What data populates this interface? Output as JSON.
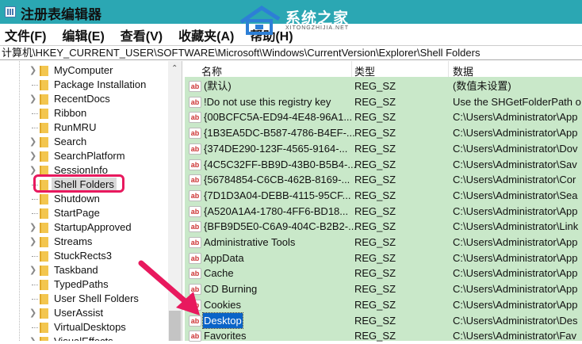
{
  "window": {
    "title": "注册表编辑器"
  },
  "watermark": {
    "name": "系统之家",
    "url": "XITONGZHIJIA.NET"
  },
  "menu": [
    "文件(F)",
    "编辑(E)",
    "查看(V)",
    "收藏夹(A)",
    "帮助(H)"
  ],
  "address": "计算机\\HKEY_CURRENT_USER\\SOFTWARE\\Microsoft\\Windows\\CurrentVersion\\Explorer\\Shell Folders",
  "tree": [
    {
      "label": "MyComputer",
      "expandable": true
    },
    {
      "label": "Package Installation",
      "expandable": false
    },
    {
      "label": "RecentDocs",
      "expandable": true
    },
    {
      "label": "Ribbon",
      "expandable": false
    },
    {
      "label": "RunMRU",
      "expandable": false
    },
    {
      "label": "Search",
      "expandable": true
    },
    {
      "label": "SearchPlatform",
      "expandable": true
    },
    {
      "label": "SessionInfo",
      "expandable": true
    },
    {
      "label": "Shell Folders",
      "expandable": false,
      "selected": true
    },
    {
      "label": "Shutdown",
      "expandable": false
    },
    {
      "label": "StartPage",
      "expandable": false
    },
    {
      "label": "StartupApproved",
      "expandable": true
    },
    {
      "label": "Streams",
      "expandable": true
    },
    {
      "label": "StuckRects3",
      "expandable": false
    },
    {
      "label": "Taskband",
      "expandable": true
    },
    {
      "label": "TypedPaths",
      "expandable": false
    },
    {
      "label": "User Shell Folders",
      "expandable": false
    },
    {
      "label": "UserAssist",
      "expandable": true
    },
    {
      "label": "VirtualDesktops",
      "expandable": false
    },
    {
      "label": "VisualEffects",
      "expandable": true
    }
  ],
  "columns": {
    "name": "名称",
    "type": "类型",
    "data": "数据"
  },
  "rows": [
    {
      "name": "(默认)",
      "type": "REG_SZ",
      "data": "(数值未设置)"
    },
    {
      "name": "!Do not use this registry key",
      "type": "REG_SZ",
      "data": "Use the SHGetFolderPath o"
    },
    {
      "name": "{00BCFC5A-ED94-4E48-96A1...",
      "type": "REG_SZ",
      "data": "C:\\Users\\Administrator\\App"
    },
    {
      "name": "{1B3EA5DC-B587-4786-B4EF-...",
      "type": "REG_SZ",
      "data": "C:\\Users\\Administrator\\App"
    },
    {
      "name": "{374DE290-123F-4565-9164-...",
      "type": "REG_SZ",
      "data": "C:\\Users\\Administrator\\Dov"
    },
    {
      "name": "{4C5C32FF-BB9D-43B0-B5B4-...",
      "type": "REG_SZ",
      "data": "C:\\Users\\Administrator\\Sav"
    },
    {
      "name": "{56784854-C6CB-462B-8169-...",
      "type": "REG_SZ",
      "data": "C:\\Users\\Administrator\\Cor"
    },
    {
      "name": "{7D1D3A04-DEBB-4115-95CF...",
      "type": "REG_SZ",
      "data": "C:\\Users\\Administrator\\Sea"
    },
    {
      "name": "{A520A1A4-1780-4FF6-BD18...",
      "type": "REG_SZ",
      "data": "C:\\Users\\Administrator\\App"
    },
    {
      "name": "{BFB9D5E0-C6A9-404C-B2B2-...",
      "type": "REG_SZ",
      "data": "C:\\Users\\Administrator\\Link"
    },
    {
      "name": "Administrative Tools",
      "type": "REG_SZ",
      "data": "C:\\Users\\Administrator\\App"
    },
    {
      "name": "AppData",
      "type": "REG_SZ",
      "data": "C:\\Users\\Administrator\\App"
    },
    {
      "name": "Cache",
      "type": "REG_SZ",
      "data": "C:\\Users\\Administrator\\App"
    },
    {
      "name": "CD Burning",
      "type": "REG_SZ",
      "data": "C:\\Users\\Administrator\\App"
    },
    {
      "name": "Cookies",
      "type": "REG_SZ",
      "data": "C:\\Users\\Administrator\\App"
    },
    {
      "name": "Desktop",
      "type": "REG_SZ",
      "data": "C:\\Users\\Administrator\\Des",
      "selected": true
    },
    {
      "name": "Favorites",
      "type": "REG_SZ",
      "data": "C:\\Users\\Administrator\\Fav"
    }
  ],
  "colors": {
    "title_bar": "#2ba7b3",
    "list_bg": "#c9e8c9",
    "highlight": "#e8195e",
    "selection": "#0a64c8"
  }
}
